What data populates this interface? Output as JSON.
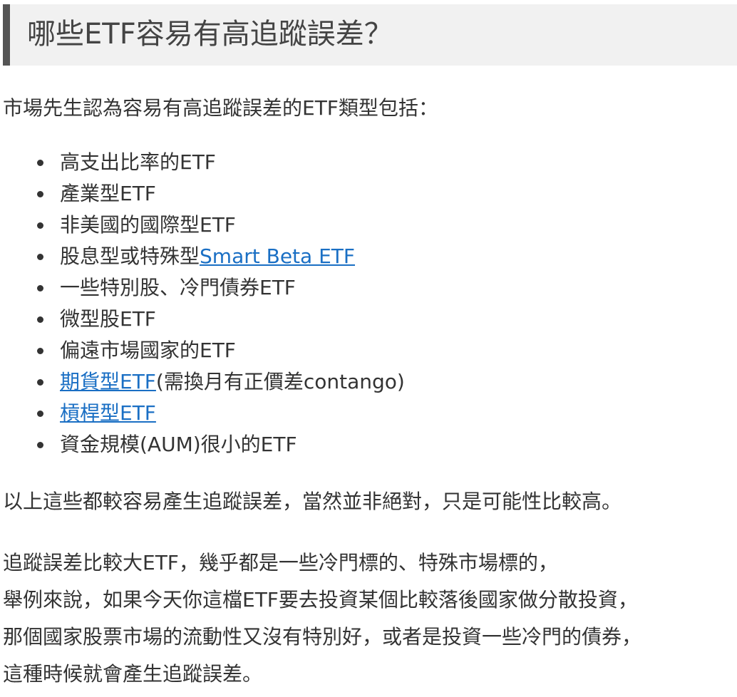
{
  "heading": "哪些ETF容易有高追蹤誤差？",
  "intro": "市場先生認為容易有高追蹤誤差的ETF類型包括：",
  "items": [
    {
      "pre": "高支出比率的ETF",
      "link": "",
      "post": ""
    },
    {
      "pre": "產業型ETF",
      "link": "",
      "post": ""
    },
    {
      "pre": "非美國的國際型ETF",
      "link": "",
      "post": ""
    },
    {
      "pre": "股息型或特殊型",
      "link": "Smart Beta ETF",
      "post": ""
    },
    {
      "pre": "一些特別股、冷門債券ETF",
      "link": "",
      "post": ""
    },
    {
      "pre": "微型股ETF",
      "link": "",
      "post": ""
    },
    {
      "pre": "偏遠市場國家的ETF",
      "link": "",
      "post": ""
    },
    {
      "pre": "",
      "link": "期貨型ETF",
      "post": "(需換月有正價差contango)"
    },
    {
      "pre": "",
      "link": "槓桿型ETF",
      "post": ""
    },
    {
      "pre": "資金規模(AUM)很小的ETF",
      "link": "",
      "post": ""
    }
  ],
  "summary": "以上這些都較容易產生追蹤誤差，當然並非絕對，只是可能性比較高。",
  "body_lines": [
    "追蹤誤差比較大ETF，幾乎都是一些冷門標的、特殊市場標的，",
    "舉例來說，如果今天你這檔ETF要去投資某個比較落後國家做分散投資，",
    "那個國家股票市場的流動性又沒有特別好，或者是投資一些冷門的債券，",
    "這種時候就會產生追蹤誤差。"
  ],
  "colors": {
    "link": "#1a6fc4",
    "heading_bg": "#f1f1f1",
    "heading_bar": "#555555",
    "text": "#333333"
  }
}
